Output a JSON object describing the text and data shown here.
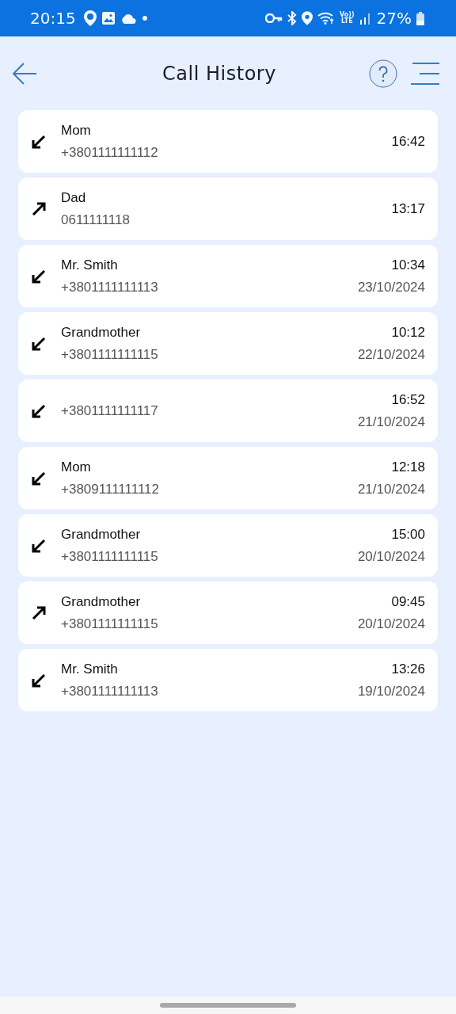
{
  "status_bar": {
    "time": "20:15",
    "volte_top": "Vo))",
    "volte_bottom": "LTE",
    "battery": "27%"
  },
  "header": {
    "title": "Call History"
  },
  "calls": [
    {
      "kind": "incoming",
      "name": "Mom",
      "number": "+3801111111112",
      "time": "16:42"
    },
    {
      "kind": "outgoing",
      "name": "Dad",
      "number": "0611111118",
      "time": "13:17"
    },
    {
      "kind": "incoming",
      "name": "Mr. Smith",
      "number": "+3801111111113",
      "time": "10:34",
      "date": "23/10/2024"
    },
    {
      "kind": "incoming",
      "name": "Grandmother",
      "number": "+3801111111115",
      "time": "10:12",
      "date": "22/10/2024"
    },
    {
      "kind": "incoming",
      "number": "+3801111111117",
      "time": "16:52",
      "date": "21/10/2024"
    },
    {
      "kind": "incoming",
      "name": "Mom",
      "number": "+3809111111112",
      "time": "12:18",
      "date": "21/10/2024"
    },
    {
      "kind": "incoming",
      "name": "Grandmother",
      "number": "+3801111111115",
      "time": "15:00",
      "date": "20/10/2024"
    },
    {
      "kind": "outgoing",
      "name": "Grandmother",
      "number": "+3801111111115",
      "time": "09:45",
      "date": "20/10/2024"
    },
    {
      "kind": "incoming",
      "name": "Mr. Smith",
      "number": "+3801111111113",
      "time": "13:26",
      "date": "19/10/2024"
    }
  ]
}
